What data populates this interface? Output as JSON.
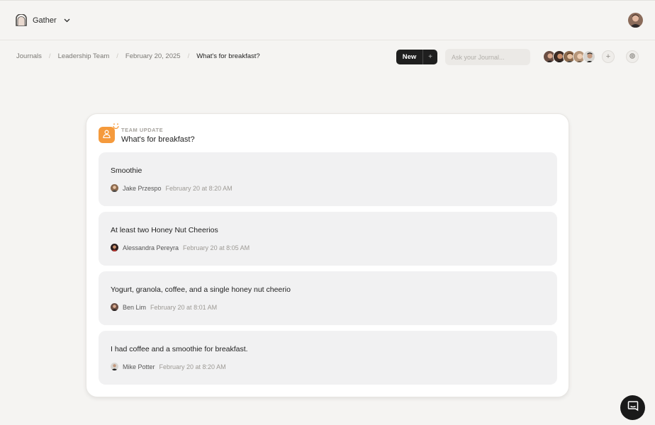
{
  "workspace": {
    "name": "Gather",
    "icon": "workspace-logo-icon"
  },
  "breadcrumb": {
    "items": [
      "Journals",
      "Leadership Team",
      "February 20, 2025"
    ],
    "current": "What's for breakfast?"
  },
  "toolbar": {
    "new_label": "New",
    "plus_label": "+",
    "search_placeholder": "Ask your Journal...",
    "add_member_label": "+",
    "settings_icon": "gear-icon"
  },
  "card": {
    "kicker": "TEAM UPDATE",
    "title": "What's for breakfast?",
    "icon": "person-icon",
    "icon_color": "#f59a3c"
  },
  "responses": [
    {
      "text": "Smoothie",
      "author": "Jake Przespo",
      "time": "February 20 at 8:20 AM"
    },
    {
      "text": "At least two Honey Nut Cheerios",
      "author": "Alessandra Pereyra",
      "time": "February 20 at 8:05 AM"
    },
    {
      "text": "Yogurt, granola, coffee, and a single honey nut cheerio",
      "author": "Ben Lim",
      "time": "February 20 at 8:01 AM"
    },
    {
      "text": "I had coffee and a smoothie for breakfast.",
      "author": "Mike Potter",
      "time": "February 20 at 8:20 AM"
    }
  ],
  "chat": {
    "icon": "chat-bubble-icon"
  }
}
